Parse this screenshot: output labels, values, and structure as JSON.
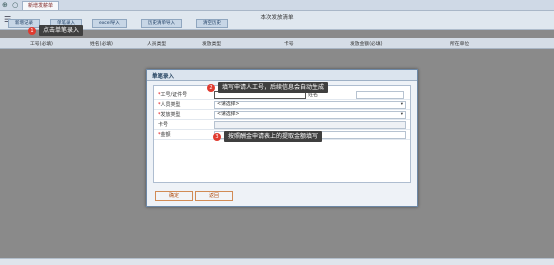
{
  "topbar": {
    "icons": "⊕ ○ ⊗",
    "tab_label": "新增发薪单"
  },
  "table": {
    "title": "本次发放清单"
  },
  "toolbar": {
    "buttons": [
      {
        "label": "新增记录"
      },
      {
        "label": "单笔录入"
      },
      {
        "label": "excel导入"
      },
      {
        "label": "历史清单导入"
      },
      {
        "label": "清空历史"
      }
    ]
  },
  "columns": [
    "工号(必填)",
    "姓名(必填)",
    "人员类型",
    "发放类型",
    "卡号",
    "发放金额(必填)",
    "所在单位"
  ],
  "callouts": {
    "c1": {
      "num": "1",
      "text": "点击单笔录入"
    },
    "c2": {
      "num": "2",
      "text": "填写申请人工号，后续信息会自动生成"
    },
    "c3": {
      "num": "3",
      "text": "按照酬金申请表上的提取金额填写"
    }
  },
  "dialog": {
    "title": "单笔录入",
    "close": "✕",
    "fields": {
      "employee_id": {
        "label": "工号/证件号",
        "value": ""
      },
      "name_label": "姓名",
      "person_type": {
        "label": "人员类型",
        "value": "<请选择>"
      },
      "pay_type": {
        "label": "发放类型",
        "value": "<请选择>"
      },
      "card": {
        "label": "卡号",
        "value": ""
      },
      "amount": {
        "label": "金额",
        "value": ""
      }
    },
    "confirm": "确定",
    "back": "返回"
  }
}
